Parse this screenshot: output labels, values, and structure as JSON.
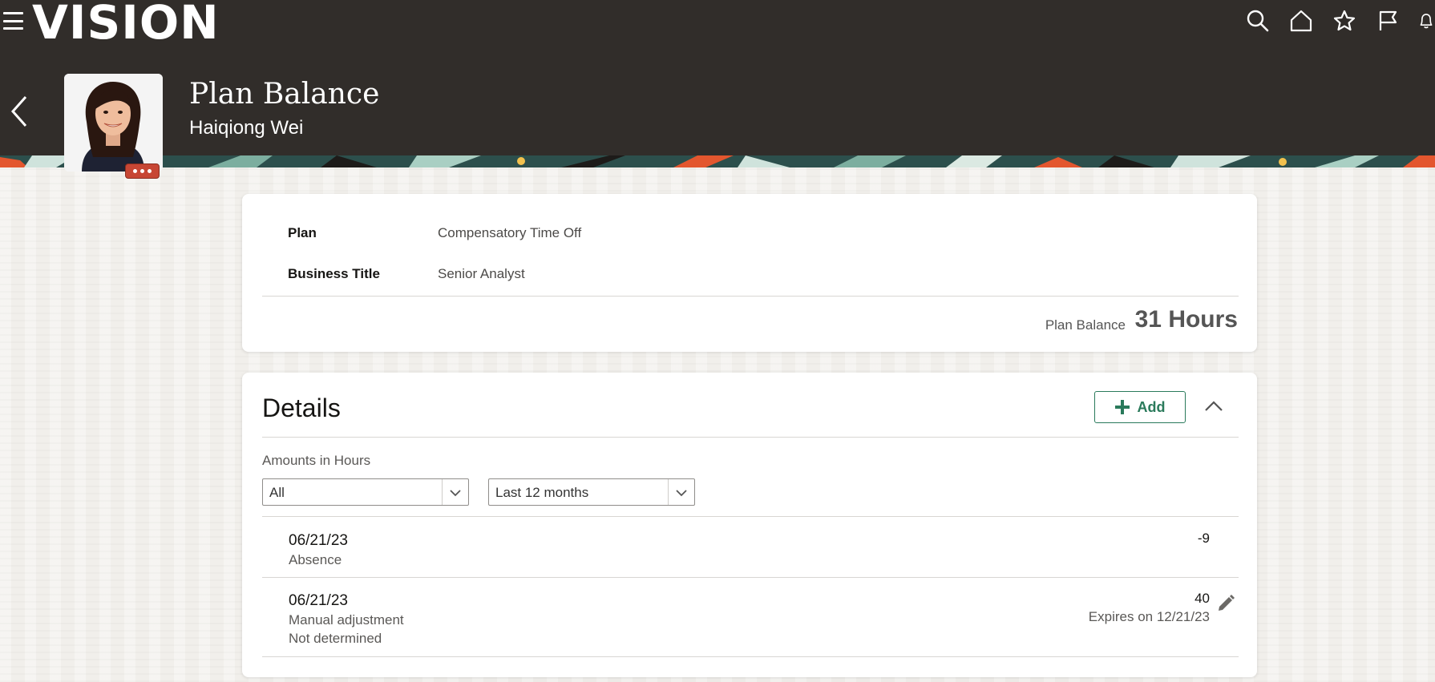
{
  "header": {
    "logo_text": "VISION",
    "title": "Plan Balance",
    "person_name": "Haiqiong Wei",
    "icons": [
      "menu-icon",
      "search-icon",
      "home-icon",
      "star-icon",
      "flag-icon",
      "bell-icon"
    ]
  },
  "plan_card": {
    "fields": [
      {
        "label": "Plan",
        "value": "Compensatory Time Off"
      },
      {
        "label": "Business Title",
        "value": "Senior Analyst"
      }
    ],
    "balance_label": "Plan Balance",
    "balance_value": "31 Hours"
  },
  "details": {
    "title": "Details",
    "add_label": "Add",
    "amounts_label": "Amounts in Hours",
    "type_filter": {
      "selected": "All"
    },
    "range_filter": {
      "selected": "Last 12 months"
    },
    "entries": [
      {
        "date": "06/21/23",
        "type": "Absence",
        "amount": "-9"
      },
      {
        "date": "06/21/23",
        "type": "Manual adjustment",
        "status": "Not determined",
        "amount": "40",
        "expiry": "Expires on 12/21/23"
      }
    ]
  },
  "colors": {
    "header_bg": "#312d2a",
    "accent_green": "#2a7a5b",
    "badge_red": "#c74634"
  }
}
